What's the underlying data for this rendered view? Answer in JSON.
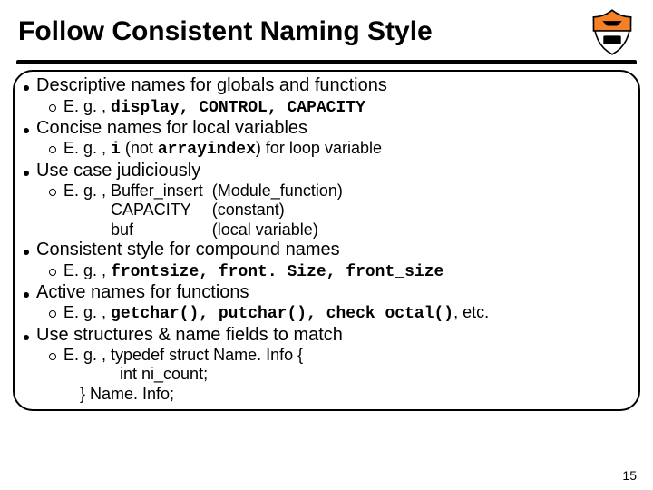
{
  "title": "Follow Consistent Naming Style",
  "page_number": "15",
  "bullets": {
    "b1": {
      "text": "Descriptive names for globals and functions",
      "sub_prefix": "E. g. , ",
      "sub_code": "display, CONTROL, CAPACITY"
    },
    "b2": {
      "text": "Concise names for local variables",
      "sub_prefix": "E. g. , ",
      "sub_code1": "i",
      "sub_mid": " (not ",
      "sub_code2": "arrayindex",
      "sub_after": ") for loop variable"
    },
    "b3": {
      "text": "Use case judiciously",
      "sub_prefix": "E. g. , ",
      "row1_l": "Buffer_insert",
      "row1_r": "(Module_function)",
      "row2_l": "CAPACITY",
      "row2_r": "(constant)",
      "row3_l": "buf",
      "row3_r": "(local variable)"
    },
    "b4": {
      "text": "Consistent style for compound names",
      "sub_prefix": "E. g. , ",
      "sub_code": "frontsize, front. Size, front_size"
    },
    "b5": {
      "text": "Active names for functions",
      "sub_prefix": "E. g. , ",
      "sub_code": "getchar(), putchar(), check_octal()",
      "sub_after": ", etc."
    },
    "b6": {
      "text": "Use structures & name fields to match",
      "sub_prefix": "E. g. , ",
      "line1": "typedef struct Name. Info {",
      "line2": "int ni_count;",
      "line3": "} Name. Info;"
    }
  }
}
